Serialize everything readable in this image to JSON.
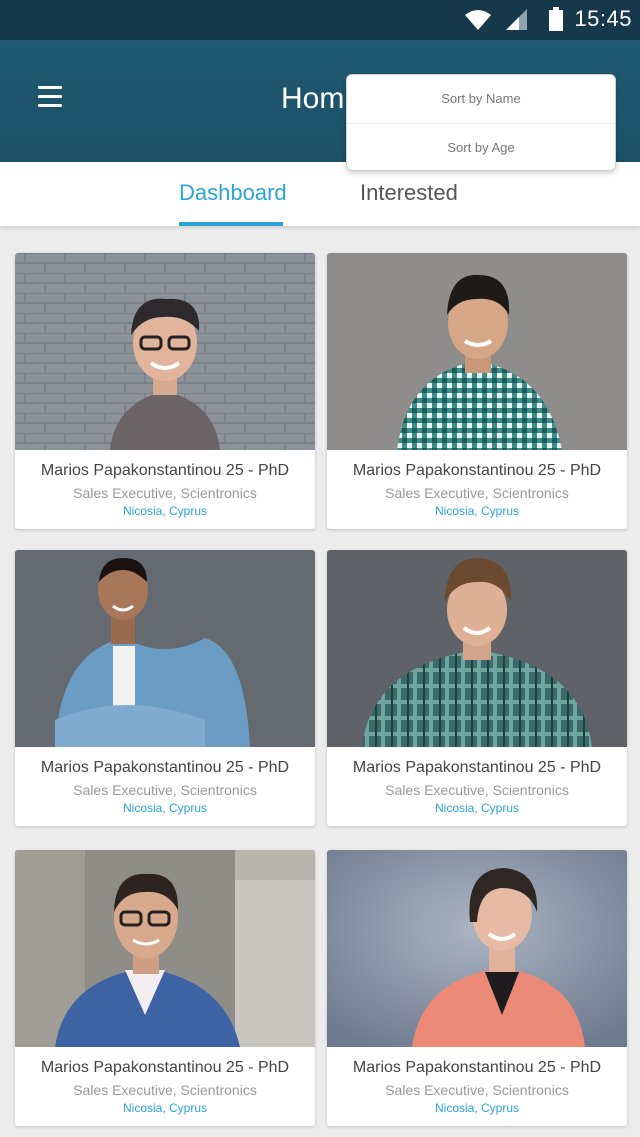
{
  "status": {
    "time": "15:45"
  },
  "header": {
    "title": "Hom"
  },
  "sort_menu": {
    "options": [
      "Sort by Name",
      "Sort by Age"
    ]
  },
  "tabs": [
    {
      "label": "Dashboard",
      "active": true
    },
    {
      "label": "Interested",
      "active": false
    }
  ],
  "profiles": [
    {
      "name": "Marios Papakonstantinou  25 - PhD",
      "role": "Sales Executive, Scientronics",
      "location": "Nicosia, Cyprus",
      "photo": "woman-glasses-brick-wall"
    },
    {
      "name": "Marios Papakonstantinou  25 - PhD",
      "role": "Sales Executive, Scientronics",
      "location": "Nicosia, Cyprus",
      "photo": "man-checkered-shirt"
    },
    {
      "name": "Marios Papakonstantinou  25 - PhD",
      "role": "Sales Executive, Scientronics",
      "location": "Nicosia, Cyprus",
      "photo": "man-denim-shirt-arms-crossed"
    },
    {
      "name": "Marios Papakonstantinou  25 - PhD",
      "role": "Sales Executive, Scientronics",
      "location": "Nicosia, Cyprus",
      "photo": "man-plaid-shirt"
    },
    {
      "name": "Marios Papakonstantinou  25 - PhD",
      "role": "Sales Executive, Scientronics",
      "location": "Nicosia, Cyprus",
      "photo": "man-glasses-blue-blazer"
    },
    {
      "name": "Marios Papakonstantinou  25 - PhD",
      "role": "Sales Executive, Scientronics",
      "location": "Nicosia, Cyprus",
      "photo": "woman-coral-blazer"
    }
  ],
  "colors": {
    "status_bar": "#15394b",
    "app_bar": "#1f5a72",
    "accent": "#2aa4d4"
  }
}
